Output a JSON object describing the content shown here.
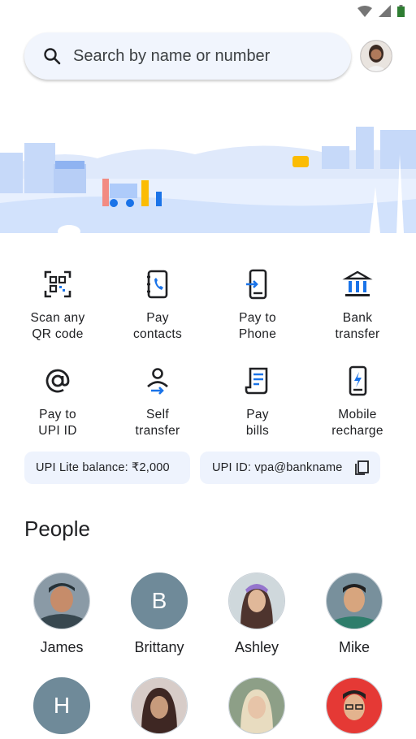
{
  "search": {
    "placeholder": "Search by name or number"
  },
  "actions": [
    {
      "label": "Scan any\nQR code",
      "icon": "qr-scan-icon"
    },
    {
      "label": "Pay\ncontacts",
      "icon": "contacts-icon"
    },
    {
      "label": "Pay to\nPhone",
      "icon": "phone-icon"
    },
    {
      "label": "Bank\ntransfer",
      "icon": "bank-icon"
    },
    {
      "label": "Pay to\nUPI ID",
      "icon": "at-icon"
    },
    {
      "label": "Self\ntransfer",
      "icon": "self-transfer-icon"
    },
    {
      "label": "Pay\nbills",
      "icon": "bill-icon"
    },
    {
      "label": "Mobile\nrecharge",
      "icon": "mobile-recharge-icon"
    }
  ],
  "chips": {
    "lite_balance": "UPI Lite balance: ₹2,000",
    "upi_id": "UPI ID: vpa@bankname"
  },
  "people": {
    "title": "People",
    "contacts": [
      {
        "name": "James",
        "initial": ""
      },
      {
        "name": "Brittany",
        "initial": "B"
      },
      {
        "name": "Ashley",
        "initial": ""
      },
      {
        "name": "Mike",
        "initial": ""
      },
      {
        "name": "",
        "initial": "H"
      },
      {
        "name": "",
        "initial": ""
      },
      {
        "name": "",
        "initial": ""
      },
      {
        "name": "",
        "initial": ""
      }
    ]
  },
  "colors": {
    "accent": "#1a73e8",
    "chip_bg": "#eef3fd",
    "initial_avatar": "#6f8a99"
  }
}
